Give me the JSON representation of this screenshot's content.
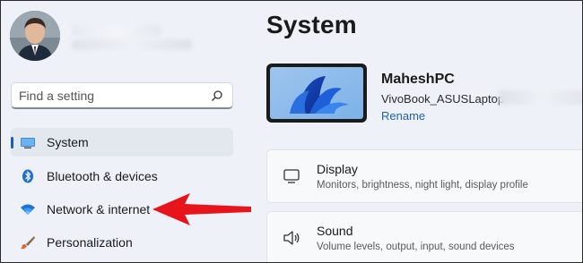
{
  "sidebar": {
    "search": {
      "placeholder": "Find a setting"
    },
    "items": [
      {
        "label": "System",
        "icon": "system-icon",
        "selected": true
      },
      {
        "label": "Bluetooth & devices",
        "icon": "bluetooth-icon",
        "selected": false
      },
      {
        "label": "Network & internet",
        "icon": "wifi-icon",
        "selected": false
      },
      {
        "label": "Personalization",
        "icon": "brush-icon",
        "selected": false
      }
    ]
  },
  "main": {
    "title": "System",
    "device": {
      "name": "MaheshPC",
      "model": "VivoBook_ASUSLaptop",
      "rename_label": "Rename"
    },
    "cards": [
      {
        "title": "Display",
        "subtitle": "Monitors, brightness, night light, display profile",
        "icon": "monitor-icon"
      },
      {
        "title": "Sound",
        "subtitle": "Volume levels, output, input, sound devices",
        "icon": "speaker-icon"
      }
    ]
  },
  "annotation": {
    "icon": "red-arrow-icon",
    "color": "#e8141c"
  },
  "colors": {
    "accent": "#1e5fb3",
    "background": "#eef2f8"
  }
}
